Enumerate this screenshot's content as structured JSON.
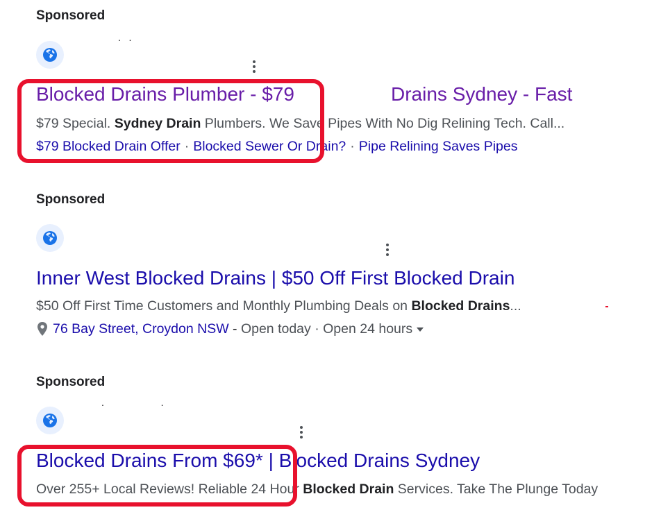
{
  "ads": [
    {
      "sponsored": "Sponsored",
      "title_left": "Blocked Drains Plumber - $79",
      "title_right": "Drains Sydney - Fast",
      "description": {
        "pre": "$79 Special. ",
        "bold": "Sydney Drain",
        "post": " Plumbers. We Save Pipes With No Dig Relining Tech. Call..."
      },
      "sitelinks": [
        "$79 Blocked Drain Offer",
        "Blocked Sewer Or Drain?",
        "Pipe Relining Saves Pipes"
      ],
      "separator": "·"
    },
    {
      "sponsored": "Sponsored",
      "title": "Inner West Blocked Drains | $50 Off First Blocked Drain",
      "description": {
        "pre": "$50 Off First Time Customers and Monthly Plumbing Deals on ",
        "bold": "Blocked Drains",
        "post": "..."
      },
      "location": {
        "address": "76 Bay Street, Croydon NSW",
        "dash": " - ",
        "open_today": "Open today",
        "separator": " · ",
        "hours": "Open 24 hours"
      }
    },
    {
      "sponsored": "Sponsored",
      "title": "Blocked Drains From $69* | Blocked Drains Sydney",
      "description": {
        "pre": "Over 255+ Local Reviews! Reliable 24 Hour ",
        "bold": "Blocked Drain",
        "post": " Services. Take The Plunge Today"
      }
    }
  ],
  "colors": {
    "link": "#1a0dab",
    "visited": "#681da8",
    "annotation_red": "#e8112d",
    "favicon_bg": "#e8f0fe",
    "favicon_icon": "#1a73e8"
  },
  "icons": {
    "favicon": "globe-icon",
    "menu": "more-vert-icon",
    "location": "location-pin-icon",
    "dropdown": "caret-down-icon"
  }
}
